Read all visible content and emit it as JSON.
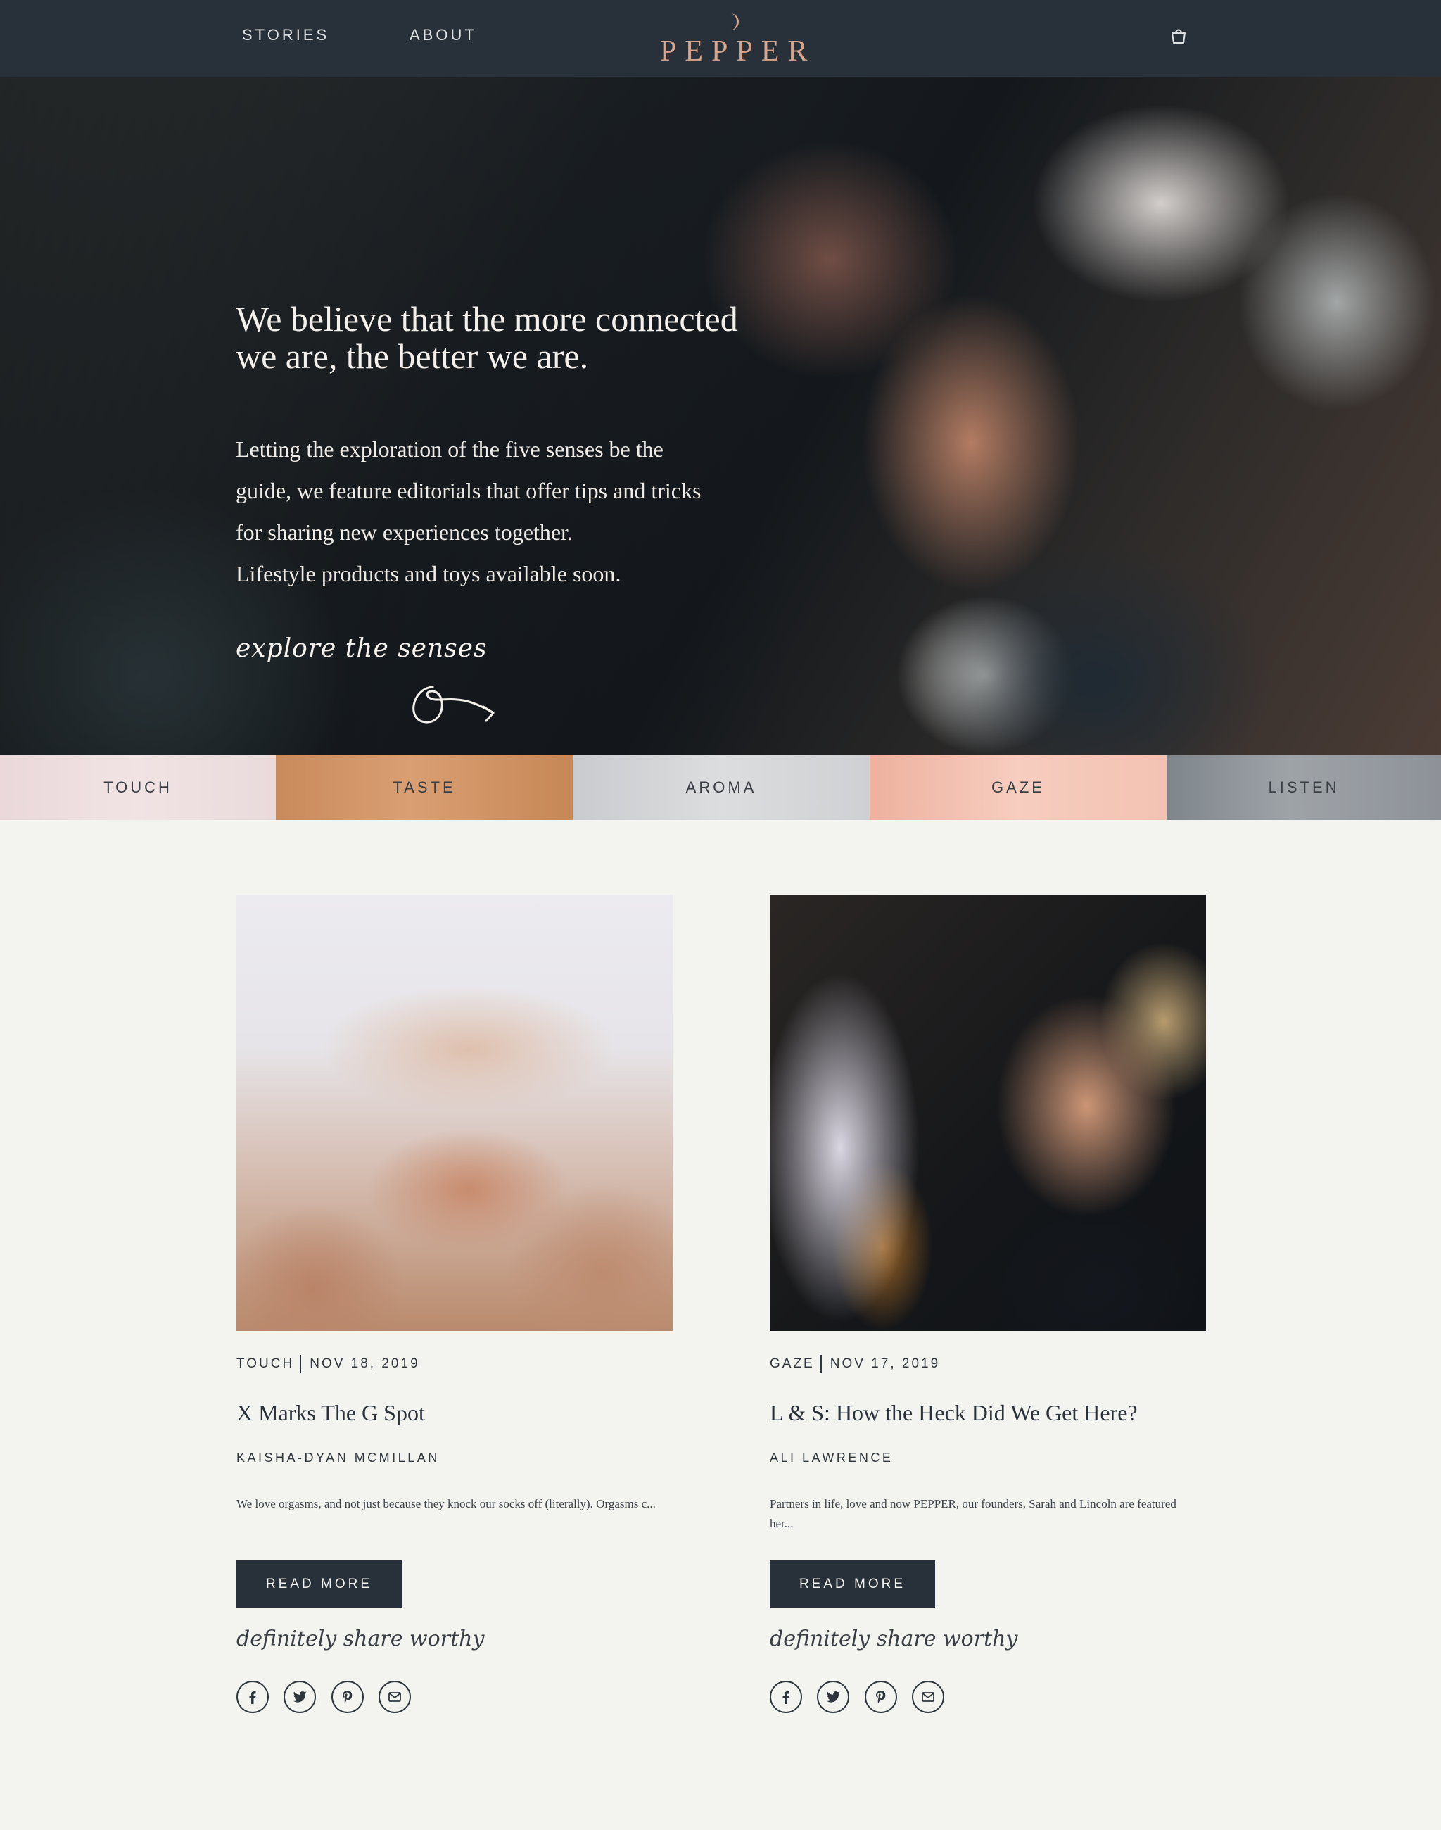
{
  "nav": {
    "stories": "STORIES",
    "about": "ABOUT",
    "logo": "PEPPER",
    "cart_icon": "shopping-bag-icon"
  },
  "hero": {
    "heading": "We believe that the more connected we are, the better we are.",
    "body_lines": [
      "Letting the exploration of the five senses be the",
      "guide, we feature editorials that offer tips and tricks",
      "for sharing new experiences together.",
      "Lifestyle products and toys available soon."
    ],
    "explore": "explore the senses"
  },
  "senses": [
    "TOUCH",
    "TASTE",
    "AROMA",
    "GAZE",
    "LISTEN"
  ],
  "articles": [
    {
      "category": "TOUCH",
      "date": "NOV 18, 2019",
      "title": "X Marks The G Spot",
      "author": "KAISHA-DYAN MCMILLAN",
      "excerpt": "We love orgasms, and not just because they knock our socks off (literally). Orgasms c...",
      "read_more": "READ MORE",
      "share_label": "definitely share worthy"
    },
    {
      "category": "GAZE",
      "date": "NOV 17, 2019",
      "title": "L & S: How the Heck Did We Get Here?",
      "author": "ALI LAWRENCE",
      "excerpt": "Partners in life, love and now PEPPER, our founders, Sarah and Lincoln are featured her...",
      "read_more": "READ MORE",
      "share_label": "definitely share worthy"
    }
  ],
  "social_icons": [
    "facebook-icon",
    "twitter-icon",
    "pinterest-icon",
    "email-icon"
  ],
  "colors": {
    "nav_bg": "#28313a",
    "logo": "#d7a58c",
    "page_bg": "#f3f3ef",
    "button_bg": "#28313a"
  }
}
